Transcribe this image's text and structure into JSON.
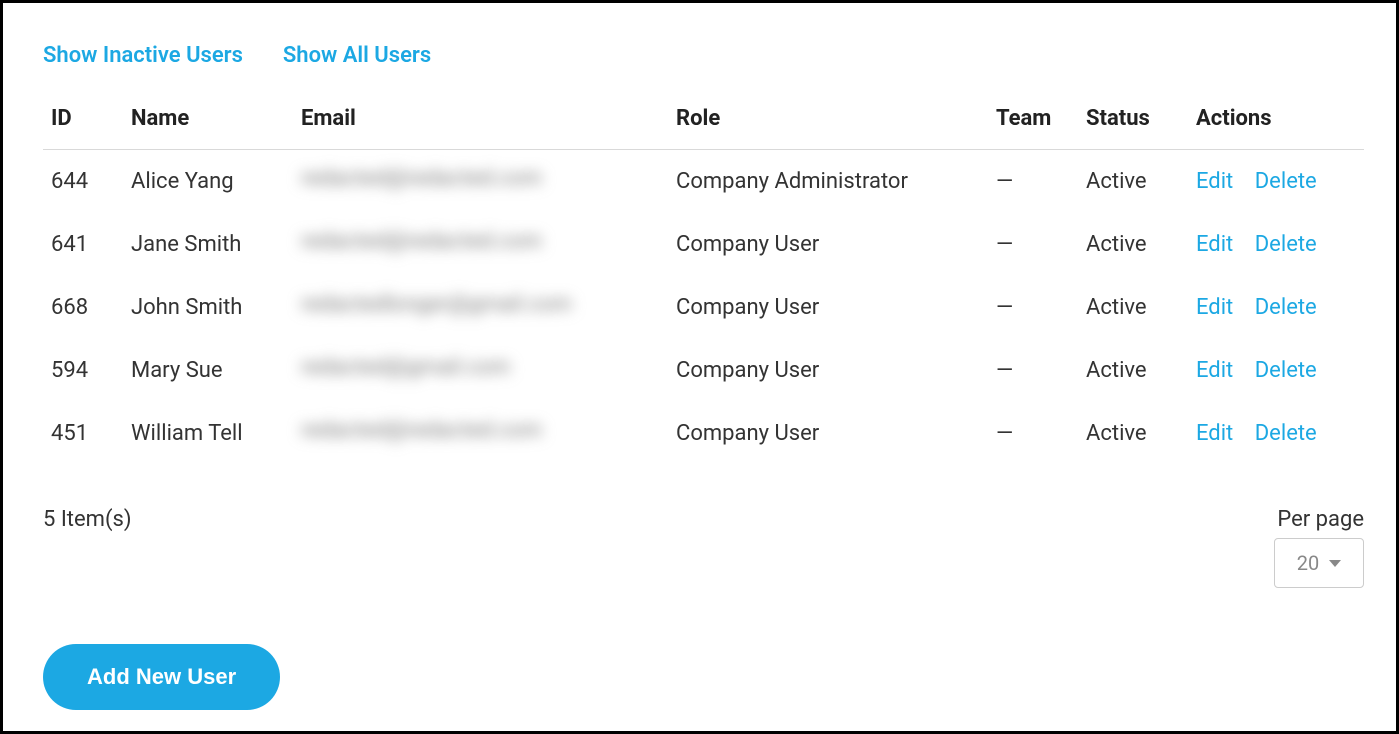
{
  "filters": {
    "show_inactive": "Show Inactive Users",
    "show_all": "Show All Users"
  },
  "table": {
    "headers": {
      "id": "ID",
      "name": "Name",
      "email": "Email",
      "role": "Role",
      "team": "Team",
      "status": "Status",
      "actions": "Actions"
    },
    "rows": [
      {
        "id": "644",
        "name": "Alice Yang",
        "email": "redacted@redacted.com",
        "role": "Company Administrator",
        "team": "—",
        "status": "Active"
      },
      {
        "id": "641",
        "name": "Jane Smith",
        "email": "redacted@redacted.com",
        "role": "Company User",
        "team": "—",
        "status": "Active"
      },
      {
        "id": "668",
        "name": "John Smith",
        "email": "redactedlonger@gmail.com",
        "role": "Company User",
        "team": "—",
        "status": "Active"
      },
      {
        "id": "594",
        "name": "Mary Sue",
        "email": "redacted@gmail.com",
        "role": "Company User",
        "team": "—",
        "status": "Active"
      },
      {
        "id": "451",
        "name": "William Tell",
        "email": "redacted@redacted.com",
        "role": "Company User",
        "team": "—",
        "status": "Active"
      }
    ],
    "action_labels": {
      "edit": "Edit",
      "delete": "Delete"
    }
  },
  "footer": {
    "items_count": "5 Item(s)",
    "per_page_label": "Per page",
    "per_page_value": "20"
  },
  "buttons": {
    "add_new_user": "Add New User"
  }
}
